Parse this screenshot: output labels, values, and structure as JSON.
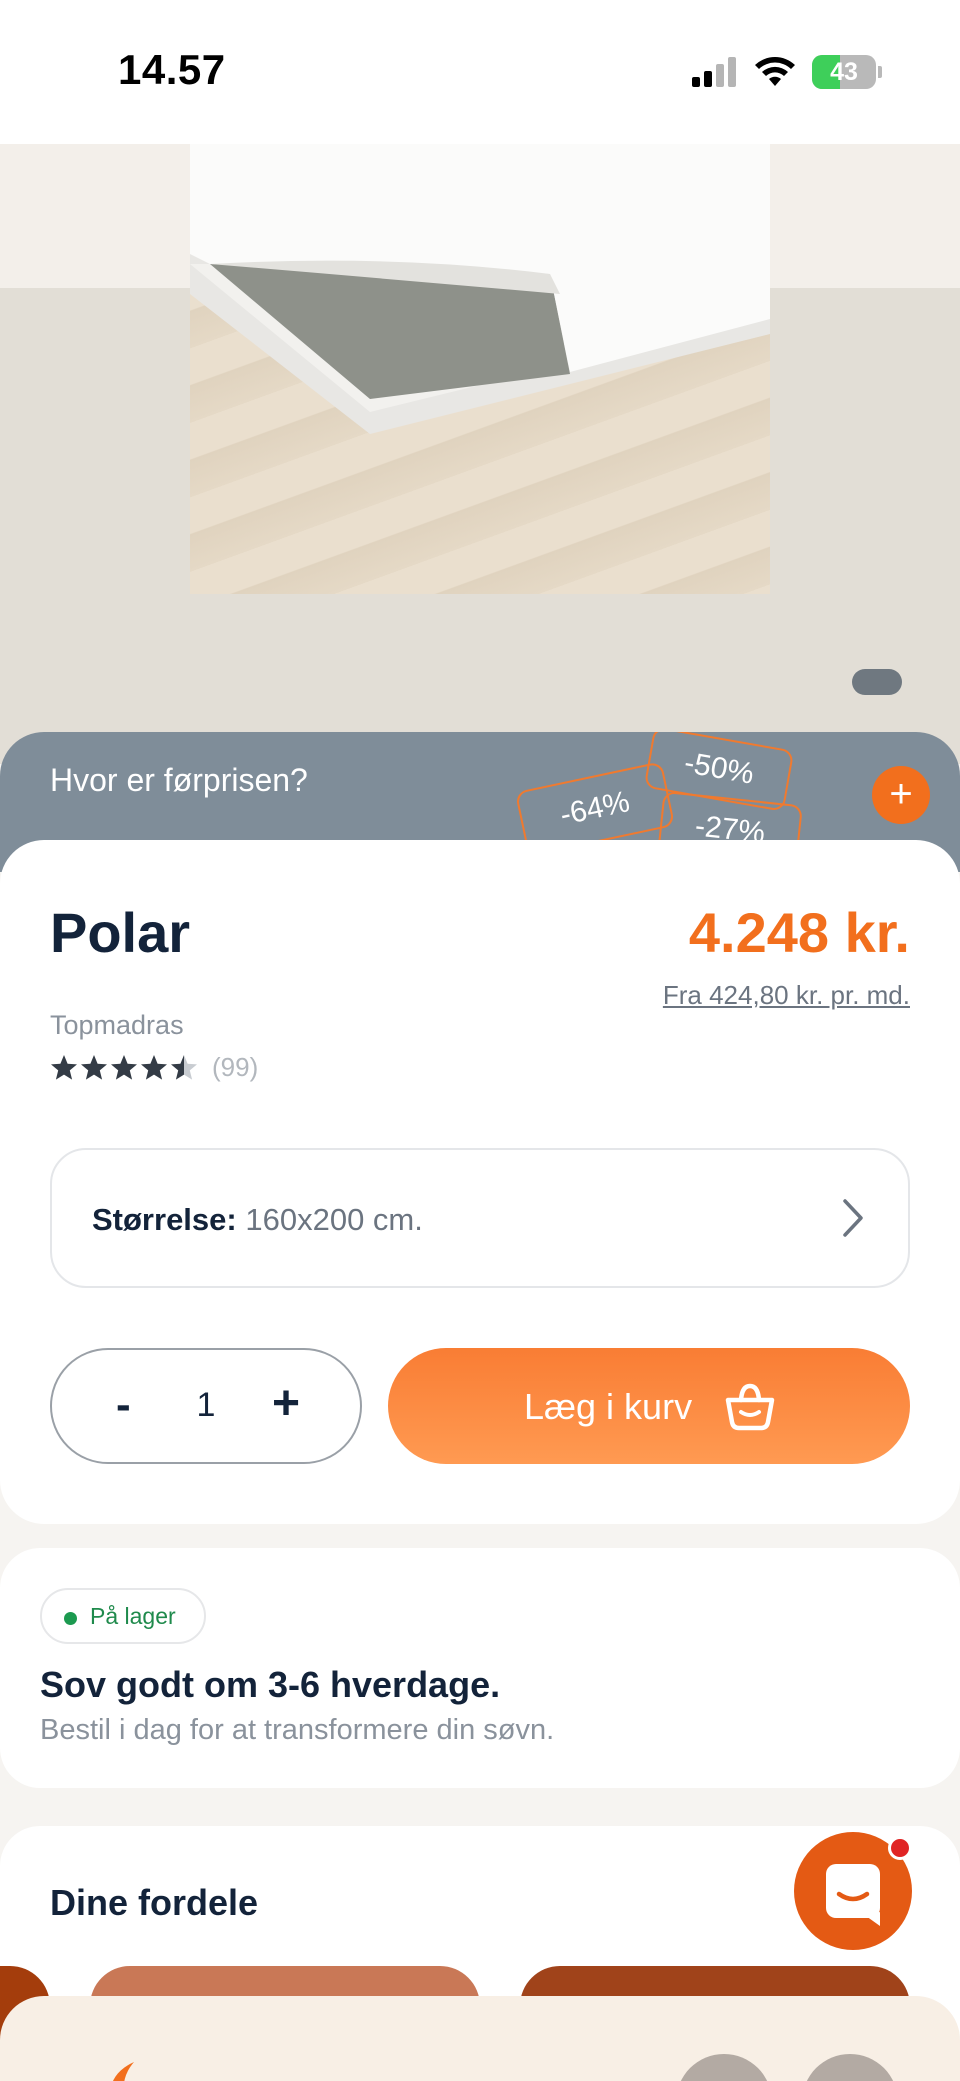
{
  "status_bar": {
    "time": "14.57",
    "battery_level": "43",
    "battery_fraction": 0.43
  },
  "hero": {
    "slide_indicator_active": 1
  },
  "price_banner": {
    "question": "Hvor er førprisen?",
    "tags": [
      "-64%",
      "-50%",
      "-27%"
    ],
    "expand_icon": "plus-icon"
  },
  "product": {
    "name": "Polar",
    "price": "4.248 kr.",
    "installment": "Fra 424,80 kr. pr. md.",
    "category": "Topmadras",
    "rating": 4.5,
    "rating_max": 5,
    "review_count": "(99)",
    "size_label": "Størrelse:",
    "size_value": "160x200 cm.",
    "quantity": "1",
    "qty_minus": "-",
    "qty_plus": "+",
    "add_to_cart": "Læg i kurv"
  },
  "stock": {
    "badge": "På lager",
    "delivery_title": "Sov godt om 3-6 hverdage.",
    "delivery_sub": "Bestil i dag for at transformere din søvn."
  },
  "benefits": {
    "title": "Dine fordele"
  },
  "colors": {
    "accent": "#f26f1d",
    "banner": "#7f8d99",
    "in_stock": "#1c9a50",
    "text_dark": "#13233a"
  }
}
